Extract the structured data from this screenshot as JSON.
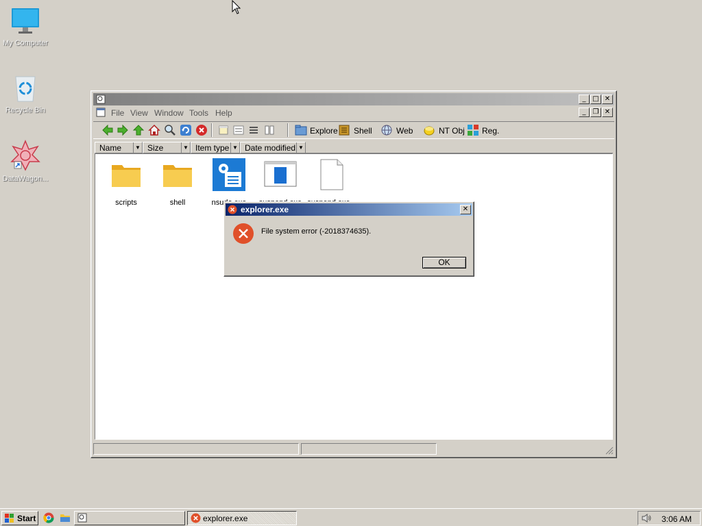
{
  "desktop": {
    "icons": [
      {
        "label": "My Computer"
      },
      {
        "label": "Recycle Bin"
      },
      {
        "label": "DataWagon..."
      }
    ]
  },
  "window": {
    "title": "",
    "menu": [
      "File",
      "View",
      "Window",
      "Tools",
      "Help"
    ],
    "toolbar_text": {
      "explore": "Explore",
      "shell": "Shell",
      "web": "Web",
      "ntobj": "NT Obj",
      "reg": "Reg."
    },
    "columns": [
      "Name",
      "Size",
      "Item type",
      "Date modified"
    ],
    "files": [
      {
        "name": "scripts",
        "icon": "folder-icon"
      },
      {
        "name": "shell",
        "icon": "folder-icon"
      },
      {
        "name": "nsudo.exe",
        "icon": "settings-app-icon"
      },
      {
        "name": "suspend.exe",
        "icon": "window-app-icon"
      },
      {
        "name": "suspend.exe...",
        "icon": "blank-file-icon"
      }
    ]
  },
  "dialog": {
    "title": "explorer.exe",
    "message": "File system error (-2018374635).",
    "ok_label": "OK"
  },
  "taskbar": {
    "start_label": "Start",
    "active_task": "explorer.exe",
    "clock": "3:06 AM"
  },
  "colors": {
    "dialog_title_start": "#0a246a",
    "dialog_title_end": "#a6caf0",
    "error_red": "#e0502a",
    "folder_yellow": "#f5c242",
    "desktop_bg": "#d4d0c8"
  }
}
